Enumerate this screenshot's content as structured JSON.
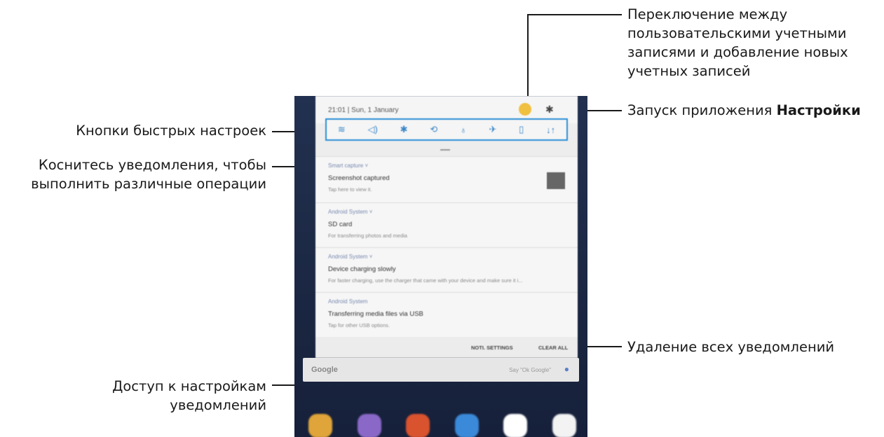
{
  "callouts": {
    "switch_accounts": [
      "Переключение между",
      "пользовательскими учетными",
      "записями и добавление новых",
      "учетных записей"
    ],
    "settings_prefix": "Запуск приложения ",
    "settings_bold": "Настройки",
    "quick_settings": "Кнопки быстрых настроек",
    "tap_notification": [
      "Коснитесь уведомления, чтобы",
      "выполнить различные операции"
    ],
    "clear_all": "Удаление всех уведомлений",
    "notif_settings": [
      "Доступ к настройкам",
      "уведомлений"
    ]
  },
  "device": {
    "time_date": "21:01 | Sun, 1 January",
    "quick_icons": [
      "wifi-icon",
      "volume-icon",
      "bluetooth-icon",
      "auto-rotate-icon",
      "flashlight-icon",
      "airplane-icon",
      "battery-saver-icon",
      "mobile-data-icon"
    ],
    "quick_glyphs": [
      "≋",
      "◁)",
      "✱",
      "⟲",
      "♁",
      "✈",
      "▯",
      "↓↑"
    ],
    "notifications": [
      {
        "app": "Smart capture ˅",
        "title": "Screenshot captured",
        "body": "Tap here to view it."
      },
      {
        "app": "Android System ˅",
        "title": "SD card",
        "body": "For transferring photos and media"
      },
      {
        "app": "Android System ˅",
        "title": "Device charging slowly",
        "body": "For faster charging, use the charger that came with your device and make sure it i..."
      },
      {
        "app": "Android System",
        "title": "Transferring media files via USB",
        "body": "Tap for other USB options."
      }
    ],
    "footer": {
      "notif_settings": "NOTI. SETTINGS",
      "clear_all": "CLEAR ALL"
    },
    "google": {
      "word": "Google",
      "hint": "Say \"Ok Google\""
    },
    "app_colors": [
      "#e0a53a",
      "#8a68c8",
      "#d9532e",
      "#3b8ad9",
      "#ffffff",
      "#f3f3f3"
    ]
  }
}
